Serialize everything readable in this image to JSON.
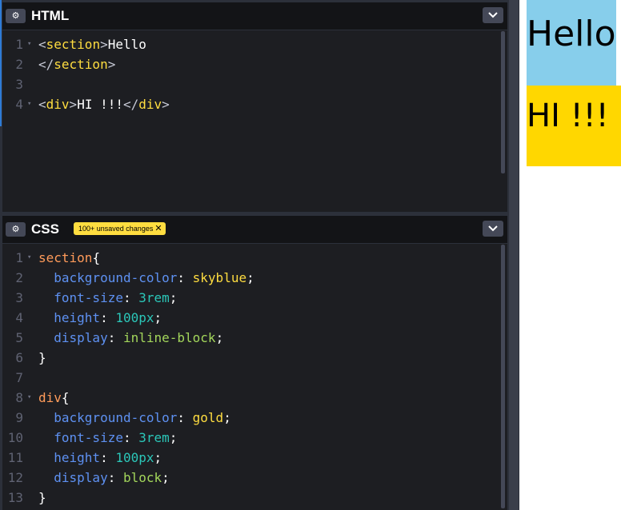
{
  "html_panel": {
    "title": "HTML",
    "lines": [
      {
        "n": "1",
        "fold": true,
        "segments": [
          [
            "c-br",
            "<"
          ],
          [
            "c-tag",
            "section"
          ],
          [
            "c-br",
            ">"
          ],
          [
            "c-txt",
            "Hello"
          ]
        ]
      },
      {
        "n": "2",
        "fold": false,
        "segments": [
          [
            "c-br",
            "</"
          ],
          [
            "c-tag",
            "section"
          ],
          [
            "c-br",
            ">"
          ]
        ]
      },
      {
        "n": "3",
        "fold": false,
        "segments": []
      },
      {
        "n": "4",
        "fold": true,
        "segments": [
          [
            "c-br",
            "<"
          ],
          [
            "c-tag",
            "div"
          ],
          [
            "c-br",
            ">"
          ],
          [
            "c-txt",
            "HI !!!"
          ],
          [
            "c-br",
            "</"
          ],
          [
            "c-tag",
            "div"
          ],
          [
            "c-br",
            ">"
          ]
        ]
      }
    ]
  },
  "css_panel": {
    "title": "CSS",
    "badge": "100+ unsaved changes",
    "badge_icon": "close-icon",
    "lines": [
      {
        "n": "1",
        "fold": true,
        "segments": [
          [
            "c-sel",
            "section"
          ],
          [
            "c-pun",
            "{"
          ]
        ]
      },
      {
        "n": "2",
        "fold": false,
        "segments": [
          [
            "c-pun",
            "  "
          ],
          [
            "c-prop",
            "background-color"
          ],
          [
            "c-pun",
            ": "
          ],
          [
            "c-val",
            "skyblue"
          ],
          [
            "c-pun",
            ";"
          ]
        ]
      },
      {
        "n": "3",
        "fold": false,
        "segments": [
          [
            "c-pun",
            "  "
          ],
          [
            "c-prop",
            "font-size"
          ],
          [
            "c-pun",
            ": "
          ],
          [
            "c-num",
            "3rem"
          ],
          [
            "c-pun",
            ";"
          ]
        ]
      },
      {
        "n": "4",
        "fold": false,
        "segments": [
          [
            "c-pun",
            "  "
          ],
          [
            "c-prop",
            "height"
          ],
          [
            "c-pun",
            ": "
          ],
          [
            "c-num",
            "100px"
          ],
          [
            "c-pun",
            ";"
          ]
        ]
      },
      {
        "n": "5",
        "fold": false,
        "segments": [
          [
            "c-pun",
            "  "
          ],
          [
            "c-prop",
            "display"
          ],
          [
            "c-pun",
            ": "
          ],
          [
            "c-kw",
            "inline-block"
          ],
          [
            "c-pun",
            ";"
          ]
        ]
      },
      {
        "n": "6",
        "fold": false,
        "segments": [
          [
            "c-pun",
            "}"
          ]
        ]
      },
      {
        "n": "7",
        "fold": false,
        "segments": []
      },
      {
        "n": "8",
        "fold": true,
        "segments": [
          [
            "c-sel",
            "div"
          ],
          [
            "c-pun",
            "{"
          ]
        ]
      },
      {
        "n": "9",
        "fold": false,
        "segments": [
          [
            "c-pun",
            "  "
          ],
          [
            "c-prop",
            "background-color"
          ],
          [
            "c-pun",
            ": "
          ],
          [
            "c-val",
            "gold"
          ],
          [
            "c-pun",
            ";"
          ]
        ]
      },
      {
        "n": "10",
        "fold": false,
        "segments": [
          [
            "c-pun",
            "  "
          ],
          [
            "c-prop",
            "font-size"
          ],
          [
            "c-pun",
            ": "
          ],
          [
            "c-num",
            "3rem"
          ],
          [
            "c-pun",
            ";"
          ]
        ]
      },
      {
        "n": "11",
        "fold": false,
        "segments": [
          [
            "c-pun",
            "  "
          ],
          [
            "c-prop",
            "height"
          ],
          [
            "c-pun",
            ": "
          ],
          [
            "c-num",
            "100px"
          ],
          [
            "c-pun",
            ";"
          ]
        ]
      },
      {
        "n": "12",
        "fold": false,
        "segments": [
          [
            "c-pun",
            "  "
          ],
          [
            "c-prop",
            "display"
          ],
          [
            "c-pun",
            ": "
          ],
          [
            "c-kw",
            "block"
          ],
          [
            "c-pun",
            ";"
          ]
        ]
      },
      {
        "n": "13",
        "fold": false,
        "segments": [
          [
            "c-pun",
            "}"
          ]
        ]
      }
    ]
  },
  "preview": {
    "section_text": "Hello",
    "div_text": "HI !!!",
    "section_color": "#87ceeb",
    "div_color": "#ffd700"
  },
  "colors": {
    "editor_bg": "#1d1e22",
    "header_bg": "#131417",
    "badge_bg": "#ffdd40"
  }
}
